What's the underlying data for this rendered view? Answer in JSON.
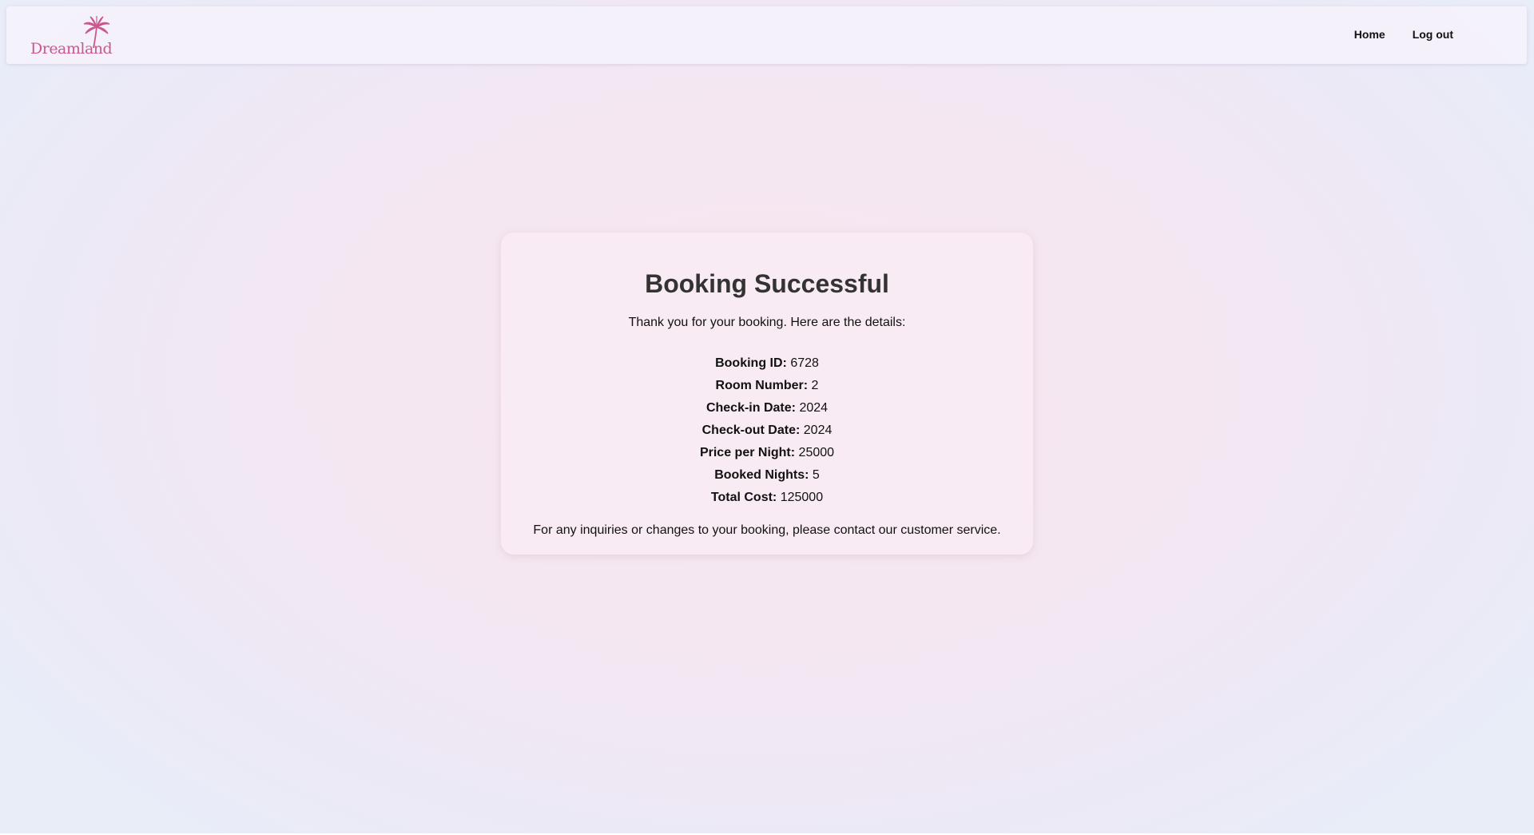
{
  "header": {
    "logo_text": "Dreamland",
    "logo_icon": "palm-tree-icon",
    "brand_color": "#c9588f",
    "nav": [
      {
        "label": "Home"
      },
      {
        "label": "Log out"
      }
    ]
  },
  "booking": {
    "title": "Booking Successful",
    "intro": "Thank you for your booking. Here are the details:",
    "details": [
      {
        "label": "Booking ID:",
        "value": "6728"
      },
      {
        "label": "Room Number:",
        "value": "2"
      },
      {
        "label": "Check-in Date:",
        "value": "2024"
      },
      {
        "label": "Check-out Date:",
        "value": "2024"
      },
      {
        "label": "Price per Night:",
        "value": "25000"
      },
      {
        "label": "Booked Nights:",
        "value": "5"
      },
      {
        "label": "Total Cost:",
        "value": "125000"
      }
    ],
    "footer": "For any inquiries or changes to your booking, please contact our customer service."
  }
}
